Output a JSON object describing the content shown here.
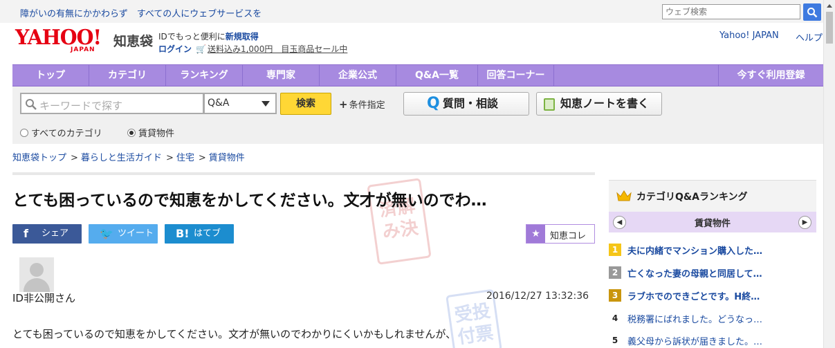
{
  "topbar": {
    "accessibility_text": "障がいの有無にかかわらず　すべての人にウェブサービスを",
    "search_placeholder": "ウェブ検索"
  },
  "header": {
    "logo_main": "YAHOO!",
    "logo_sub": "JAPAN",
    "logo_service": "知恵袋",
    "promo_line1_prefix": "IDでもっと便利に",
    "promo_line1_link": "新規取得",
    "promo_login": "ログイン",
    "promo_sale": "送料込み1,000円　目玉商品セール中",
    "yahoo_japan_link": "Yahoo! JAPAN",
    "help_link": "ヘルプ"
  },
  "nav": {
    "items": [
      "トップ",
      "カテゴリ",
      "ランキング",
      "専門家",
      "企業公式",
      "Q&A一覧",
      "回答コーナー"
    ],
    "register": "今すぐ利用登録"
  },
  "search": {
    "keyword_placeholder": "キーワードで探す",
    "type_value": "Q&A",
    "button": "検索",
    "conditions": "条件指定",
    "ask_button_q": "Q",
    "ask_button": "質問・相談",
    "note_button": "知恵ノートを書く",
    "radio_all": "すべてのカテゴリ",
    "radio_current": "賃貸物件"
  },
  "breadcrumb": [
    "知恵袋トップ",
    "暮らしと生活ガイド",
    "住宅",
    "賃貸物件"
  ],
  "question": {
    "title": "とても困っているので知恵をかしてください。文才が無いのでわ…",
    "share_facebook": "シェア",
    "share_twitter": "ツイート",
    "share_hatena": "はてブ",
    "chie_colle": "知恵コレ",
    "stamp_resolved": "済解\nみ決",
    "stamp_vote": "受投\n付票",
    "user": "ID非公開さん",
    "date": "2016/12/27  13:32:36",
    "body": "とても困っているので知恵をかしてください。文才が無いのでわかりにくいかもしれませんが、"
  },
  "sidebar": {
    "heading": "カテゴリQ&Aランキング",
    "category": "賃貸物件",
    "ranking": [
      {
        "rank": "1",
        "text": "夫に内緒でマンション購入した…"
      },
      {
        "rank": "2",
        "text": "亡くなった妻の母親と同居して…"
      },
      {
        "rank": "3",
        "text": "ラブホでのできごとです。H終…"
      },
      {
        "rank": "4",
        "text": "税務署にばれました。どうなっ…"
      },
      {
        "rank": "5",
        "text": "義父母から訴状が届きました。…"
      }
    ]
  },
  "colors": {
    "nav_purple": "#a78ae0",
    "search_yellow": "#ffd735",
    "link_blue": "#1a4aa0",
    "brand_red": "#e60012"
  }
}
